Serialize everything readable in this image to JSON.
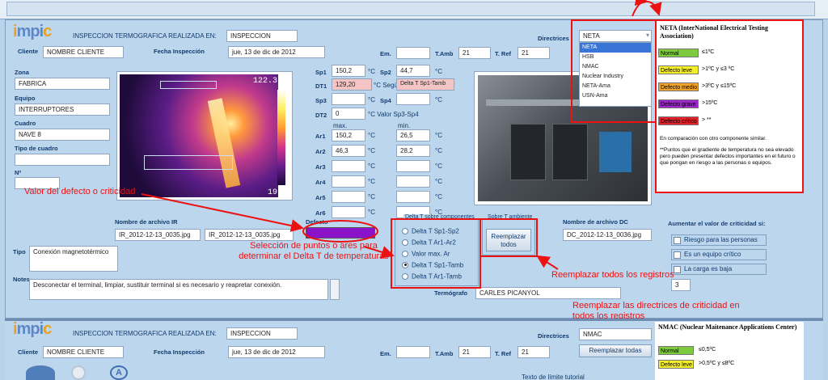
{
  "header": {
    "logo": "impic",
    "title": "INSPECCION TERMOGRAFICA REALIZADA EN:",
    "title_value": "INSPECCION",
    "directrices_label": "Directrices",
    "directrices_value": "NETA"
  },
  "client": {
    "label": "Cliente",
    "value": "NOMBRE CLIENTE"
  },
  "fecha": {
    "label": "Fecha Inspección",
    "value": "jue, 13 de dic de 2012"
  },
  "em": {
    "label": "Em.",
    "value": ""
  },
  "tamb": {
    "label": "T.Amb",
    "value": "21"
  },
  "tref": {
    "label": "T. Ref",
    "value": "21"
  },
  "left_fields": {
    "zona_label": "Zona",
    "zona_value": "FABRICA",
    "equipo_label": "Equipo",
    "equipo_value": "INTERRUPTORES",
    "cuadro_label": "Cuadro",
    "cuadro_value": "NAVE 8",
    "tipo_cuadro_label": "Tipo de cuadro",
    "tipo_cuadro_value": "",
    "n_label": "Nº",
    "n_value": ""
  },
  "thermal": {
    "max_temp": "122.3 °C",
    "min_temp": "19.8"
  },
  "measures": {
    "sp1_label": "Sp1",
    "sp1": "150,2",
    "sp2_label": "Sp2",
    "sp2": "44,7",
    "unit": "°C",
    "dt1_label": "DT1",
    "dt1": "129,20",
    "segun": "°C Según",
    "dt1_ref": "Delta T Sp1-Tamb",
    "sp3_label": "Sp3",
    "sp3": "",
    "sp4_label": "Sp4",
    "sp4": "",
    "dt2_label": "DT2",
    "dt2": "0",
    "dt2_ref": "°C    Valor Sp3-Sp4",
    "max_label": "max.",
    "min_label": "min.",
    "ar": [
      {
        "label": "Ar1",
        "max": "150,2",
        "min": "26,5"
      },
      {
        "label": "Ar2",
        "max": "46,3",
        "min": "28,2"
      },
      {
        "label": "Ar3",
        "max": "",
        "min": ""
      },
      {
        "label": "Ar4",
        "max": "",
        "min": ""
      },
      {
        "label": "Ar5",
        "max": "",
        "min": ""
      },
      {
        "label": "Ar6",
        "max": "",
        "min": ""
      }
    ]
  },
  "ir_file": {
    "label": "Nombre de archivo IR",
    "value1": "IR_2012-12-13_0035.jpg",
    "value2": "IR_2012-12-13_0035.jpg"
  },
  "dc_file": {
    "label": "Nombre de archivo DC",
    "value": "DC_2012-12-13_0036.jpg"
  },
  "defecto": {
    "label": "Defecto",
    "color": "#8a12c9"
  },
  "delta_group": {
    "title": "Delta T sobre componentes",
    "options": [
      "Delta T Sp1-Sp2",
      "Delta T Ar1-Ar2",
      "Valor max. Ar",
      "Delta T Sp1-Tamb",
      "Delta T Ar1-Tamb"
    ],
    "selected_index": 3
  },
  "reemplazar": {
    "title": "Sobre T ambiente",
    "button": "Reemplazar todos"
  },
  "tipo": {
    "label": "Tipo",
    "value": "Conexión magnetotérmico"
  },
  "notes": {
    "label": "Notes",
    "value": "Desconectar el terminal, limpiar, sustituir terminal si es necesario y reapretar conexión."
  },
  "termografo": {
    "label": "Termógrafo",
    "value": "CARLES PICANYOL"
  },
  "criticidad": {
    "title": "Aumentar el valor de criticidad si:",
    "items": [
      "Riesgo para las personas",
      "Es un equipo crítico",
      "La carga es baja"
    ],
    "count": "3"
  },
  "dropdown": {
    "options": [
      "NETA",
      "HSB",
      "NMAC",
      "Nuclear Industry",
      "NETA-Ama",
      "USN-Ama"
    ],
    "selected_index": 0
  },
  "neta_panel": {
    "title": "NETA (InterNational Electrical Testing Association)",
    "levels": [
      {
        "name": "Normal",
        "color": "#7ec93d",
        "desc": "≤1ºC"
      },
      {
        "name": "Defecto  leve",
        "color": "#f3ee2b",
        "desc": ">1ºC  y  ≤3 ºC"
      },
      {
        "name": "Defecto  medio",
        "color": "#f0a22c",
        "desc": ">3ºC y  ≤15ºC"
      },
      {
        "name": "Defecto  grave",
        "color": "#9b27c9",
        "desc": ">15ºC"
      },
      {
        "name": "Defecto  crítico",
        "color": "#e2222c",
        "desc": "> **"
      }
    ],
    "note1": "En comparación con otro componente similar.",
    "note2": "**Puntos que el gradiente de temperatura no sea elevado pero pueden presentar defectos importantes en el futuro o que pongan en riesgo a las personas o equipos."
  },
  "annotations": {
    "valor": "Valor del defecto o criticidad",
    "seleccion": "Selección de puntos o ares para determinar  el Delta T de temperaturas",
    "reemplazar_registros": "Reemplazar todos los registros",
    "reemplazar_directrices": "Reemplazar las directrices de criticidad en todos los registros",
    "color": "#e11111"
  },
  "second": {
    "title": "INSPECCION TERMOGRAFICA REALIZADA EN:",
    "title_value": "INSPECCION",
    "directrices_value": "NMAC",
    "client_value": "NOMBRE CLIENTE",
    "fecha_value": "jue, 13 de dic de 2012",
    "tamb": "21",
    "tref": "21",
    "button": "Reemplazar todas",
    "panel_title": "NMAC (Nuclear Maitenance Applications Center)",
    "level_normal": "Normal",
    "level_normal_desc": "≤0,5ºC",
    "level2": "Defecto leve",
    "level2_desc": ">0,5ºC y ≤8ºC",
    "footer_text": "Texto de límite tutorial"
  }
}
